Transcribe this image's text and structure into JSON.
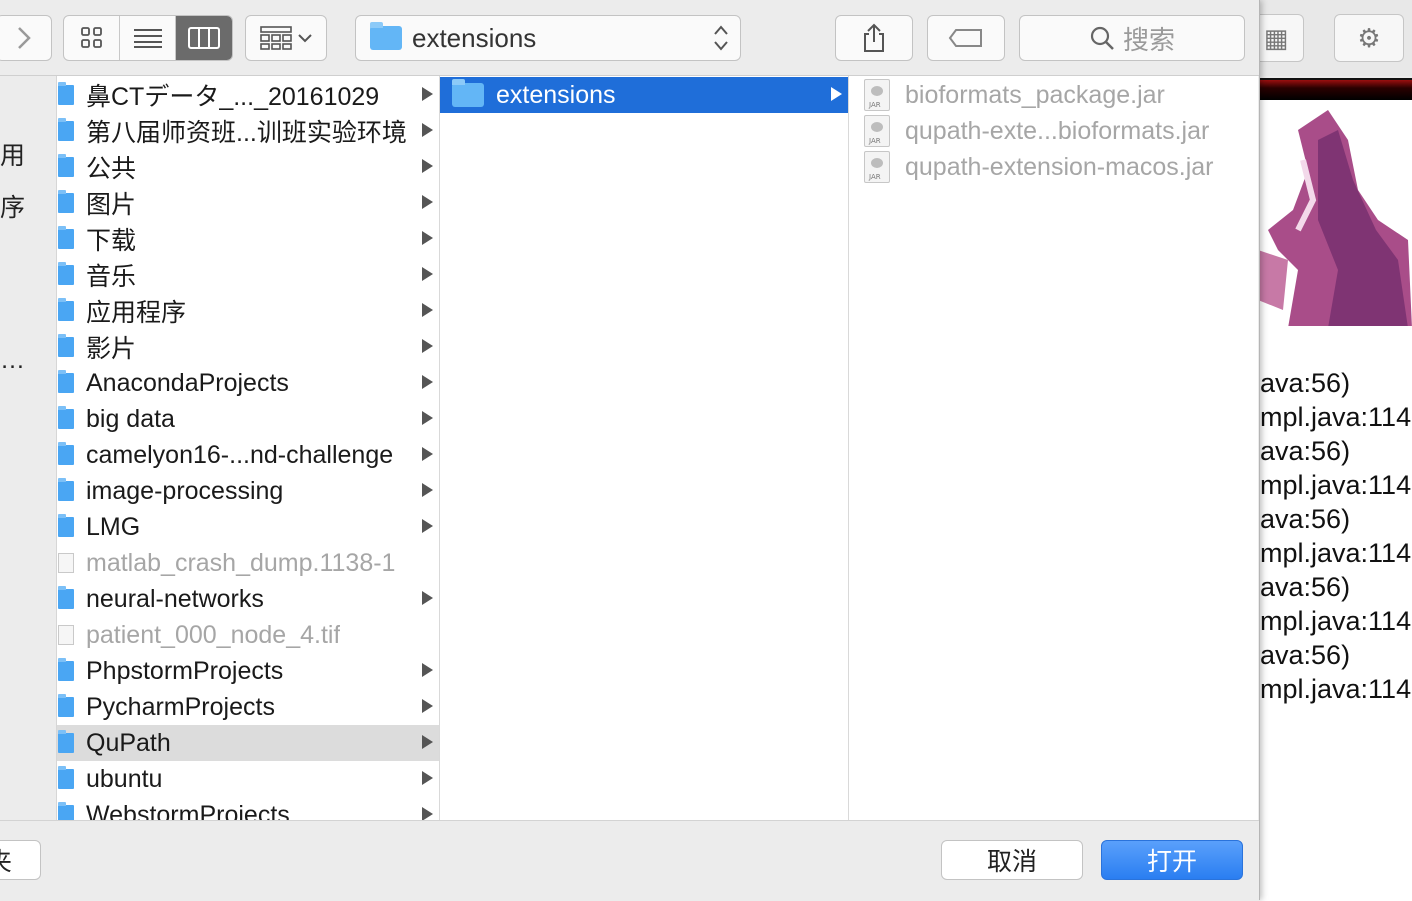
{
  "toolbar": {
    "path_label": "extensions",
    "search_placeholder": "搜索"
  },
  "sidebar": {
    "fragments": [
      "用",
      "序",
      "…"
    ]
  },
  "column1": {
    "items": [
      {
        "name": "鼻CTデータ_..._20161029",
        "kind": "folder",
        "has_children": true,
        "state": "normal"
      },
      {
        "name": "第八届师资班...训班实验环境",
        "kind": "folder",
        "has_children": true,
        "state": "normal"
      },
      {
        "name": "公共",
        "kind": "folder",
        "has_children": true,
        "state": "normal"
      },
      {
        "name": "图片",
        "kind": "folder",
        "has_children": true,
        "state": "normal"
      },
      {
        "name": "下载",
        "kind": "folder",
        "has_children": true,
        "state": "normal"
      },
      {
        "name": "音乐",
        "kind": "folder",
        "has_children": true,
        "state": "normal"
      },
      {
        "name": "应用程序",
        "kind": "folder",
        "has_children": true,
        "state": "normal"
      },
      {
        "name": "影片",
        "kind": "folder",
        "has_children": true,
        "state": "normal"
      },
      {
        "name": "AnacondaProjects",
        "kind": "folder",
        "has_children": true,
        "state": "normal"
      },
      {
        "name": "big data",
        "kind": "folder",
        "has_children": true,
        "state": "normal"
      },
      {
        "name": "camelyon16-...nd-challenge",
        "kind": "folder",
        "has_children": true,
        "state": "normal"
      },
      {
        "name": "image-processing",
        "kind": "folder",
        "has_children": true,
        "state": "normal"
      },
      {
        "name": "LMG",
        "kind": "folder",
        "has_children": true,
        "state": "normal"
      },
      {
        "name": "matlab_crash_dump.1138-1",
        "kind": "file",
        "has_children": false,
        "state": "dim"
      },
      {
        "name": "neural-networks",
        "kind": "folder",
        "has_children": true,
        "state": "normal"
      },
      {
        "name": "patient_000_node_4.tif",
        "kind": "file",
        "has_children": false,
        "state": "dim"
      },
      {
        "name": "PhpstormProjects",
        "kind": "folder",
        "has_children": true,
        "state": "normal"
      },
      {
        "name": "PycharmProjects",
        "kind": "folder",
        "has_children": true,
        "state": "normal"
      },
      {
        "name": "QuPath",
        "kind": "folder",
        "has_children": true,
        "state": "selected-inactive"
      },
      {
        "name": "ubuntu",
        "kind": "folder",
        "has_children": true,
        "state": "normal"
      },
      {
        "name": "WebstormProjects",
        "kind": "folder",
        "has_children": true,
        "state": "normal"
      }
    ]
  },
  "column2": {
    "items": [
      {
        "name": "extensions",
        "kind": "folder",
        "has_children": true,
        "state": "selected"
      }
    ]
  },
  "column3": {
    "items": [
      {
        "name": "bioformats_package.jar",
        "kind": "jar",
        "state": "dim"
      },
      {
        "name": "qupath-exte...bioformats.jar",
        "kind": "jar",
        "state": "dim"
      },
      {
        "name": "qupath-extension-macos.jar",
        "kind": "jar",
        "state": "dim"
      }
    ],
    "jar_badge": "JAR"
  },
  "buttons": {
    "new_folder_fragment": "夹",
    "cancel": "取消",
    "open": "打开"
  },
  "background_console": {
    "lines": [
      "ava:56)",
      "mpl.java:114",
      "ava:56)",
      "mpl.java:114",
      "ava:56)",
      "mpl.java:114",
      "ava:56)",
      "mpl.java:114",
      "ava:56)",
      "mpl.java:114"
    ]
  },
  "colors": {
    "selection_blue": "#1f6ed9",
    "folder_blue": "#4aa6f3",
    "open_button_blue": "#2a7ef1"
  }
}
